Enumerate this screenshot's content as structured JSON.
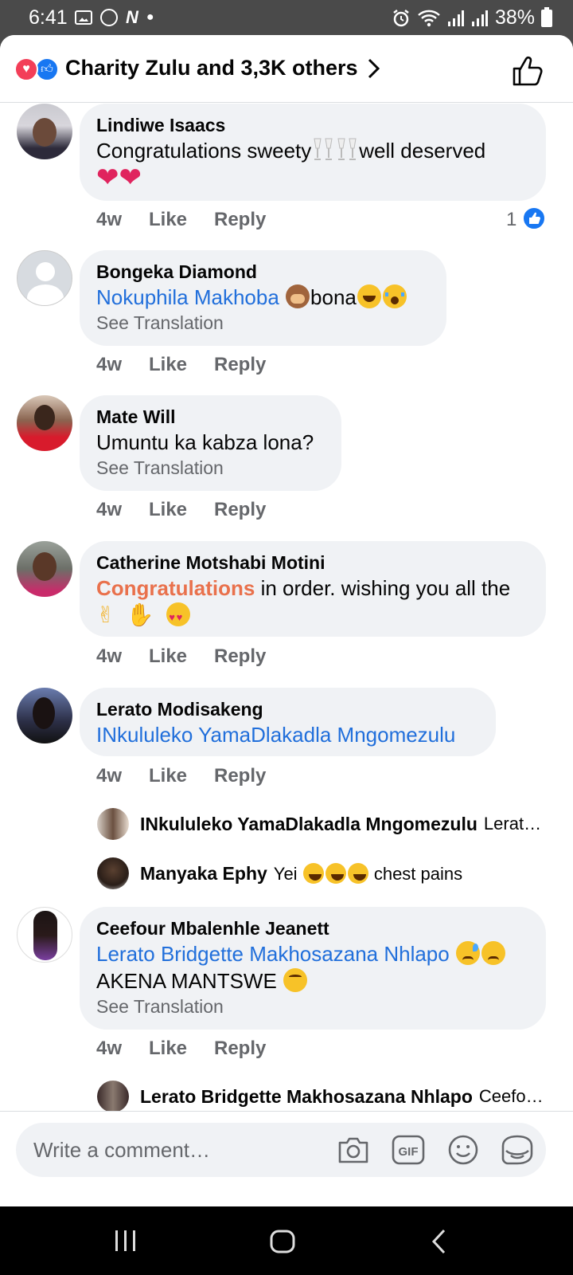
{
  "status": {
    "time": "6:41",
    "battery": "38%"
  },
  "header": {
    "reactors": "Charity Zulu and 3,3K others"
  },
  "comments": [
    {
      "name": "Lindiwe Isaacs",
      "text_a": "Congratulations sweety",
      "text_b": "well deserved",
      "time": "4w",
      "like": "Like",
      "reply": "Reply",
      "like_count": "1"
    },
    {
      "name": "Bongeka Diamond",
      "mention": "Nokuphila Makhoba",
      "text": "bona",
      "see_translation": "See Translation",
      "time": "4w",
      "like": "Like",
      "reply": "Reply"
    },
    {
      "name": "Mate Will",
      "text": "Umuntu ka kabza lona?",
      "see_translation": "See Translation",
      "time": "4w",
      "like": "Like",
      "reply": "Reply"
    },
    {
      "name": "Catherine Motshabi Motini",
      "highlight": "Congratulations",
      "text": "in order. wishing you all the",
      "time": "4w",
      "like": "Like",
      "reply": "Reply"
    },
    {
      "name": "Lerato Modisakeng",
      "mention": "INkululeko YamaDlakadla Mngomezulu",
      "time": "4w",
      "like": "Like",
      "reply": "Reply",
      "replies": [
        {
          "name": "INkululeko YamaDlakadla Mngomezulu",
          "text": "Lerato…"
        },
        {
          "name": "Manyaka Ephy",
          "text_a": "Yei",
          "text_b": "chest pains"
        }
      ]
    },
    {
      "name": "Ceefour Mbalenhle Jeanett",
      "mention": "Lerato Bridgette Makhosazana Nhlapo",
      "text": "AKENA MANTSWE",
      "see_translation": "See Translation",
      "time": "4w",
      "like": "Like",
      "reply": "Reply",
      "replies": [
        {
          "name": "Lerato Bridgette Makhosazana Nhlapo",
          "text": "Ceefo…"
        }
      ]
    }
  ],
  "input": {
    "placeholder": "Write a comment…",
    "gif_label": "GIF"
  },
  "colors": {
    "brand_blue": "#1877f2",
    "mention_blue": "#216fdb",
    "bubble_bg": "#f0f2f5",
    "meta_gray": "#65676b",
    "highlight_orange": "#e9714c"
  },
  "icons": [
    "wifi-icon",
    "signal-icon",
    "alarm-icon",
    "camera-icon",
    "gif-icon",
    "emoji-icon",
    "sticker-icon",
    "thumbs-up-icon",
    "chevron-right-icon",
    "recents-icon",
    "home-icon",
    "back-icon"
  ]
}
